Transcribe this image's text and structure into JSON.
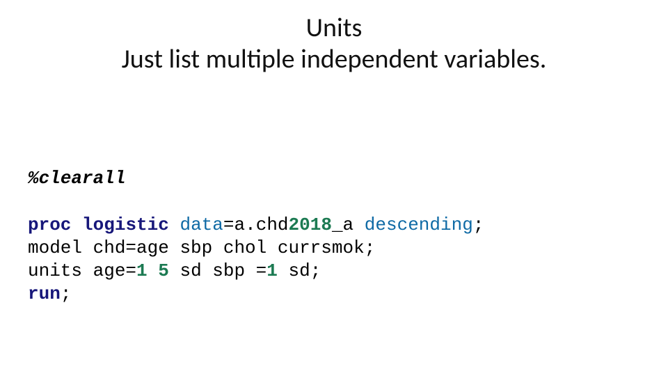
{
  "title": {
    "line1": "Units",
    "line2": "Just list multiple independent variables."
  },
  "code": {
    "macro_pct": "%",
    "macro_name": "clearall",
    "kw_proc": "proc",
    "kw_logistic": "logistic",
    "opt_data": "data",
    "eq1": "=",
    "val_dataset_a": "a",
    "dot": ".",
    "val_dataset_b": "chd",
    "val_dataset_year": "2018",
    "val_dataset_suffix": "_a",
    "opt_descending": "descending",
    "semi1": ";",
    "kw_model": "model",
    "txt_model_rest": " chd=age sbp chol currsmok",
    "semi2": ";",
    "kw_units": "units",
    "txt_units_a": " age=",
    "num_1a": "1",
    "sp1": " ",
    "num_5": "5",
    "txt_units_b": " sd sbp =",
    "num_1b": "1",
    "txt_units_c": " sd",
    "semi3": ";",
    "kw_run": "run",
    "semi4": ";"
  }
}
